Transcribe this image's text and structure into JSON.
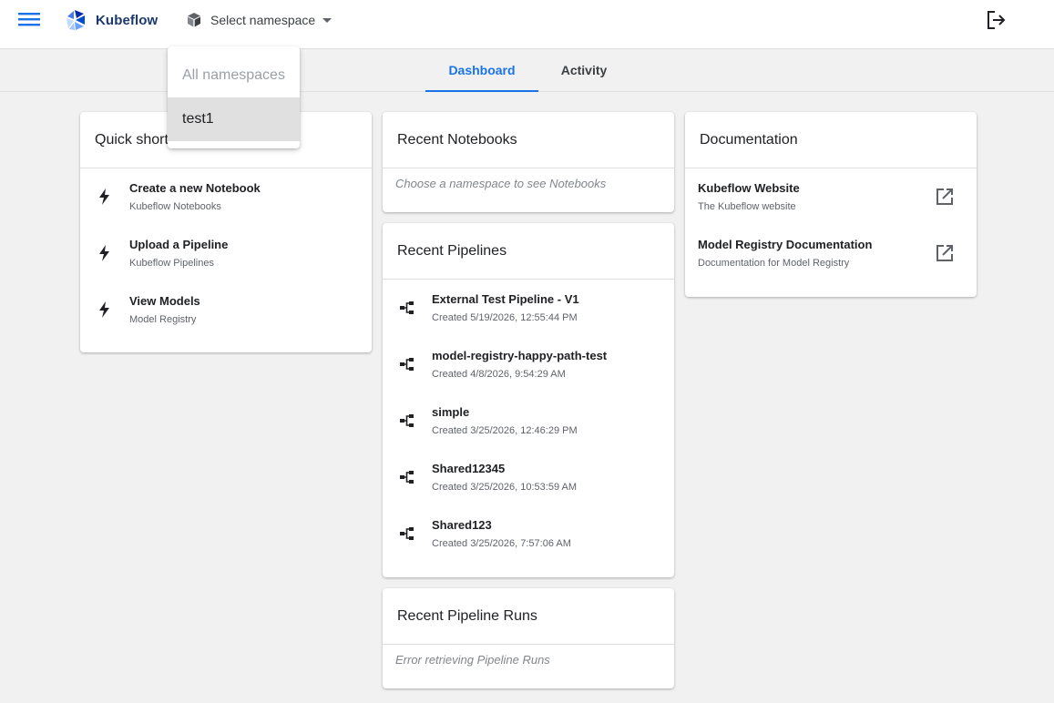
{
  "header": {
    "menu_icon": "menu-icon",
    "logo_text": "Kubeflow",
    "namespace_icon": "cube-icon",
    "namespace_placeholder": "Select namespace",
    "logout_icon": "logout-icon"
  },
  "tabs": [
    {
      "label": "Dashboard",
      "active": true
    },
    {
      "label": "Activity",
      "active": false
    }
  ],
  "namespace_dropdown": {
    "options": [
      "All namespaces",
      "test1"
    ],
    "highlighted": "test1"
  },
  "quick_shortcuts": {
    "title": "Quick shortcuts",
    "items": [
      {
        "title": "Create a new Notebook",
        "subtitle": "Kubeflow Notebooks",
        "icon": "bolt-icon"
      },
      {
        "title": "Upload a Pipeline",
        "subtitle": "Kubeflow Pipelines",
        "icon": "bolt-icon"
      },
      {
        "title": "View Models",
        "subtitle": "Model Registry",
        "icon": "bolt-icon"
      }
    ]
  },
  "recent_notebooks": {
    "title": "Recent Notebooks",
    "empty_text": "Choose a namespace to see Notebooks"
  },
  "recent_pipelines": {
    "title": "Recent Pipelines",
    "items": [
      {
        "title": "External Test Pipeline - V1",
        "subtitle": "Created 5/19/2026, 12:55:44 PM"
      },
      {
        "title": "model-registry-happy-path-test",
        "subtitle": "Created 4/8/2026, 9:54:29 AM"
      },
      {
        "title": "simple",
        "subtitle": "Created 3/25/2026, 12:46:29 PM"
      },
      {
        "title": "Shared12345",
        "subtitle": "Created 3/25/2026, 10:53:59 AM"
      },
      {
        "title": "Shared123",
        "subtitle": "Created 3/25/2026, 7:57:06 AM"
      }
    ]
  },
  "recent_pipeline_runs": {
    "title": "Recent Pipeline Runs",
    "empty_text": "Error retrieving Pipeline Runs"
  },
  "documentation": {
    "title": "Documentation",
    "items": [
      {
        "title": "Kubeflow Website",
        "subtitle": "The Kubeflow website",
        "icon": "open-in-new-icon"
      },
      {
        "title": "Model Registry Documentation",
        "subtitle": "Documentation for Model Registry",
        "icon": "open-in-new-icon"
      }
    ]
  },
  "colors": {
    "accent": "#1a73e8",
    "logo_blue": "#1a3a6e",
    "background": "#f1f1f1"
  }
}
